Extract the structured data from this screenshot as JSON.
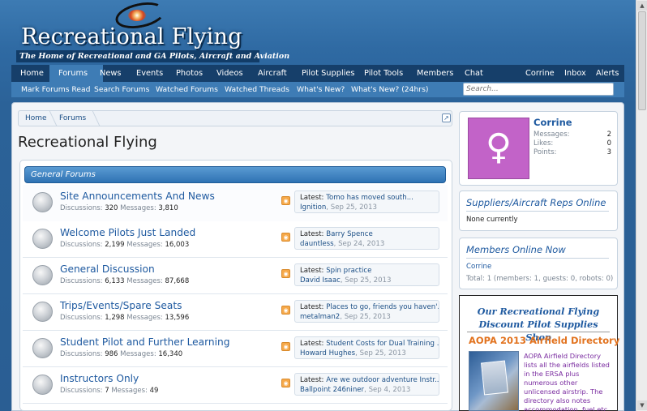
{
  "header": {
    "site_title": "Recreational Flying",
    "tagline": "The Home of Recreational and GA Pilots, Aircraft and Aviation"
  },
  "nav": {
    "items": [
      "Home",
      "Forums",
      "News",
      "Events",
      "Photos",
      "Videos",
      "Aircraft",
      "Pilot Supplies",
      "Pilot Tools",
      "Members",
      "Chat"
    ],
    "active": "Forums",
    "user_items": [
      "Corrine",
      "Inbox",
      "Alerts"
    ]
  },
  "subnav": {
    "items": [
      "Mark Forums Read",
      "Search Forums",
      "Watched Forums",
      "Watched Threads",
      "What's New?",
      "What's New? (24hrs)"
    ],
    "search_placeholder": "Search..."
  },
  "breadcrumb": [
    "Home",
    "Forums"
  ],
  "page_title": "Recreational Flying",
  "category": "General Forums",
  "labels": {
    "discussions": "Discussions:",
    "messages": "Messages:",
    "latest": "Latest:"
  },
  "forums": [
    {
      "name": "Site Announcements And News",
      "discussions": "320",
      "messages": "3,810",
      "latest_title": "Tomo has moved south...",
      "latest_user": "Ignition",
      "latest_date": "Sep 25, 2013"
    },
    {
      "name": "Welcome Pilots Just Landed",
      "discussions": "2,199",
      "messages": "16,003",
      "latest_title": "Barry Spence",
      "latest_user": "dauntless",
      "latest_date": "Sep 24, 2013"
    },
    {
      "name": "General Discussion",
      "discussions": "6,133",
      "messages": "87,668",
      "latest_title": "Spin practice",
      "latest_user": "David Isaac",
      "latest_date": "Sep 25, 2013"
    },
    {
      "name": "Trips/Events/Spare Seats",
      "discussions": "1,298",
      "messages": "13,596",
      "latest_title": "Places to go, friends you haven'...",
      "latest_user": "metalman2",
      "latest_date": "Sep 25, 2013"
    },
    {
      "name": "Student Pilot and Further Learning",
      "discussions": "986",
      "messages": "16,340",
      "latest_title": "Student Costs for Dual Training ...",
      "latest_user": "Howard Hughes",
      "latest_date": "Sep 25, 2013"
    },
    {
      "name": "Instructors Only",
      "discussions": "7",
      "messages": "49",
      "latest_title": "Are we outdoor adventure Instr...",
      "latest_user": "Ballpoint 246niner",
      "latest_date": "Sep 4, 2013"
    }
  ],
  "visitor": {
    "name": "Corrine",
    "stats": [
      {
        "label": "Messages:",
        "value": "2"
      },
      {
        "label": "Likes:",
        "value": "0"
      },
      {
        "label": "Points:",
        "value": "3"
      }
    ]
  },
  "suppliers_online": {
    "title": "Suppliers/Aircraft Reps Online",
    "text": "None currently"
  },
  "members_online": {
    "title": "Members Online Now",
    "member": "Corrine",
    "total": "Total: 1 (members: 1, guests: 0, robots: 0)"
  },
  "shop": {
    "title": "Our Recreational Flying Discount Pilot Supplies Shop",
    "product_title": "AOPA 2013 Airfield Directory",
    "product_text": "AOPA Airfield Directory lists all the airfields listed in the ERSA plus numerous other unlicensed airstrip. The directory also notes accommodation, fuel etc"
  },
  "colors": {
    "link": "#1f5aa0",
    "nav_bg": "#163f6a",
    "subnav_bg": "#3e7cb5",
    "accent_orange": "#e2731f",
    "avatar": "#c263c8"
  }
}
